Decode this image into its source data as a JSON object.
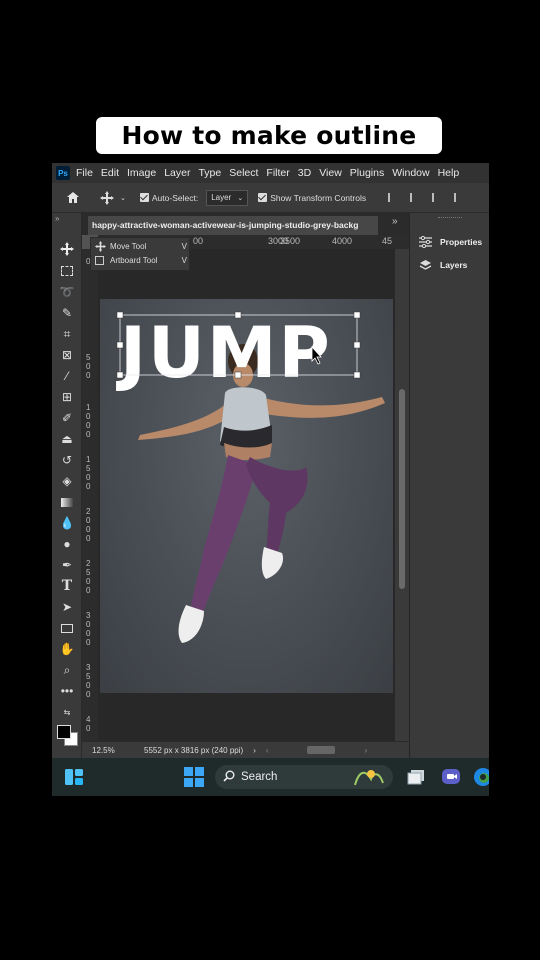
{
  "caption": "How to make outline text",
  "menu": {
    "logo": "Ps",
    "items": [
      "File",
      "Edit",
      "Image",
      "Layer",
      "Type",
      "Select",
      "Filter",
      "3D",
      "View",
      "Plugins",
      "Window",
      "Help"
    ]
  },
  "options": {
    "auto_select_label": "Auto-Select:",
    "auto_select_value": "Layer",
    "show_transform_label": "Show Transform Controls"
  },
  "document": {
    "tab_title": "happy-attractive-woman-activewear-is-jumping-studio-grey-backg",
    "ruler_top_ticks": [
      "00",
      "3000",
      "3500",
      "4000",
      "45"
    ],
    "ruler_left_ticks": [
      "0",
      "5 0 0",
      "1 0 0 0",
      "1 5 0 0",
      "2 0 0 0",
      "2 5 0 0",
      "3 0 0 0",
      "3 5 0 0",
      "4 0"
    ],
    "canvas_text": "JUMP"
  },
  "flyout": {
    "items": [
      {
        "label": "Move Tool",
        "shortcut": "V"
      },
      {
        "label": "Artboard Tool",
        "shortcut": "V"
      }
    ]
  },
  "panels": {
    "properties_label": "Properties",
    "layers_label": "Layers"
  },
  "status": {
    "zoom": "12.5%",
    "doc_info": "5552 px x 3816 px (240 ppi)"
  },
  "taskbar": {
    "search_label": "Search"
  },
  "colors": {
    "app_bg": "#535353",
    "menubar": "#323232",
    "taskbar": "#1f2a2a",
    "accent_blue": "#31a8ff"
  }
}
